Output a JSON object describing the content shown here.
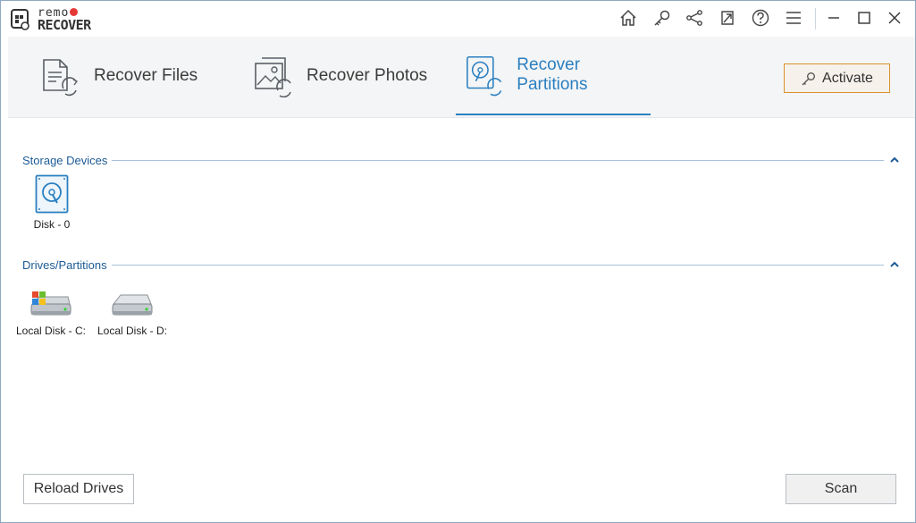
{
  "app": {
    "logo_top": "remo",
    "logo_bottom": "RECOVER"
  },
  "titlebar": {
    "icons": [
      "home-icon",
      "key-icon",
      "share-icon",
      "export-icon",
      "help-icon",
      "menu-icon",
      "minimize-icon",
      "maximize-icon",
      "close-icon"
    ]
  },
  "nav": {
    "tabs": [
      {
        "label": "Recover Files",
        "icon": "recover-files-icon",
        "active": false
      },
      {
        "label": "Recover Photos",
        "icon": "recover-photos-icon",
        "active": false
      },
      {
        "label": "Recover Partitions",
        "icon": "recover-partitions-icon",
        "active": true
      }
    ],
    "activate_label": "Activate"
  },
  "storage": {
    "title": "Storage Devices",
    "devices": [
      {
        "label": "Disk - 0",
        "icon": "hard-disk-icon"
      }
    ]
  },
  "drives": {
    "title": "Drives/Partitions",
    "items": [
      {
        "label": "Local Disk - C:",
        "icon": "windows-drive-icon"
      },
      {
        "label": "Local Disk - D:",
        "icon": "local-drive-icon"
      }
    ]
  },
  "footer": {
    "reload_label": "Reload Drives",
    "scan_label": "Scan"
  },
  "colors": {
    "accent": "#2a7fc0",
    "activate_border": "#d9922e",
    "section_text": "#1d5b96"
  }
}
